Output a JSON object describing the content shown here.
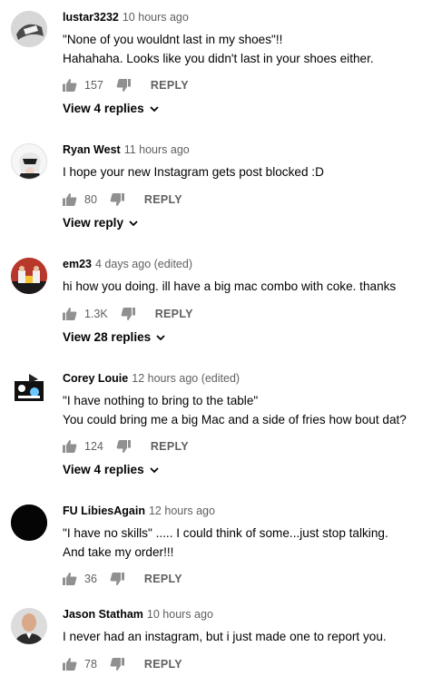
{
  "comments": [
    {
      "author": "lustar3232",
      "time": "10 hours ago",
      "text": "\"None of you wouldnt last in my shoes\"!!\nHahahaha. Looks like you didn't last in your shoes either.",
      "likes": "157",
      "reply_label": "REPLY",
      "view_label": "View 4 replies"
    },
    {
      "author": "Ryan West",
      "time": "11 hours ago",
      "text": "I hope your new Instagram gets post blocked :D",
      "likes": "80",
      "reply_label": "REPLY",
      "view_label": "View reply"
    },
    {
      "author": "em23",
      "time": "4 days ago (edited)",
      "text": "hi how you doing.  ill have a big mac combo with coke.  thanks",
      "likes": "1.3K",
      "reply_label": "REPLY",
      "view_label": "View 28 replies"
    },
    {
      "author": "Corey Louie",
      "time": "12 hours ago (edited)",
      "text": "\"I have nothing to bring to the table\"\nYou could bring me a big Mac and a side of fries how bout dat?",
      "likes": "124",
      "reply_label": "REPLY",
      "view_label": "View 4 replies"
    },
    {
      "author": "FU LibiesAgain",
      "time": "12 hours ago",
      "text": "\"I have no skills\" .....  I could think of some...just stop talking.\nAnd take my order!!!",
      "likes": "36",
      "reply_label": "REPLY"
    },
    {
      "author": "Jason Statham",
      "time": "10 hours ago",
      "text": "I never had an instagram, but i just made one to report you.",
      "likes": "78",
      "reply_label": "REPLY"
    }
  ],
  "icons": {
    "like": "thumbs-up-icon",
    "dislike": "thumbs-down-icon",
    "chevron": "chevron-down-icon"
  },
  "colors": {
    "text": "#030303",
    "secondary": "#606060"
  }
}
